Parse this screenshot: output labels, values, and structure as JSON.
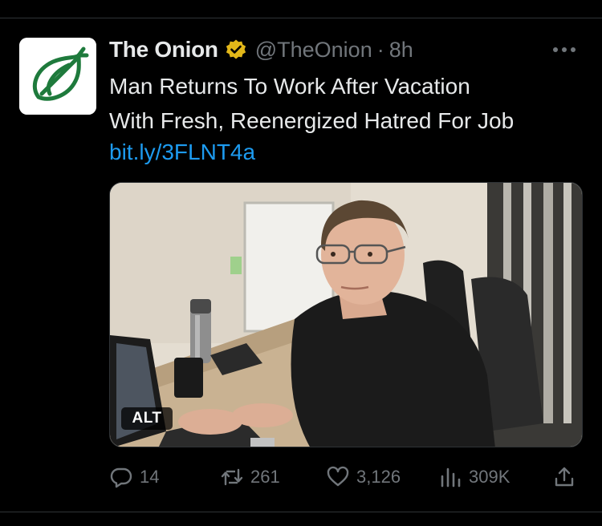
{
  "tweet": {
    "author_name": "The Onion",
    "handle": "@TheOnion",
    "separator": "·",
    "time": "8h",
    "text_lines": [
      "Man Returns To Work After Vacation",
      "With Fresh, Reenergized Hatred For Job"
    ],
    "link": "bit.ly/3FLNT4a"
  },
  "media": {
    "alt_badge": "ALT"
  },
  "actions": {
    "replies": "14",
    "retweets": "261",
    "likes": "3,126",
    "views": "309K"
  },
  "colors": {
    "background": "#000000",
    "text": "#e7e9ea",
    "secondary": "#71767b",
    "link": "#1d9bf0",
    "verified_gold": "#e2b719",
    "onion_green": "#1e7a3c"
  },
  "icons": [
    "onion-logo",
    "verified-gold-badge",
    "more-icon",
    "reply-icon",
    "retweet-icon",
    "like-icon",
    "views-icon",
    "share-icon"
  ]
}
